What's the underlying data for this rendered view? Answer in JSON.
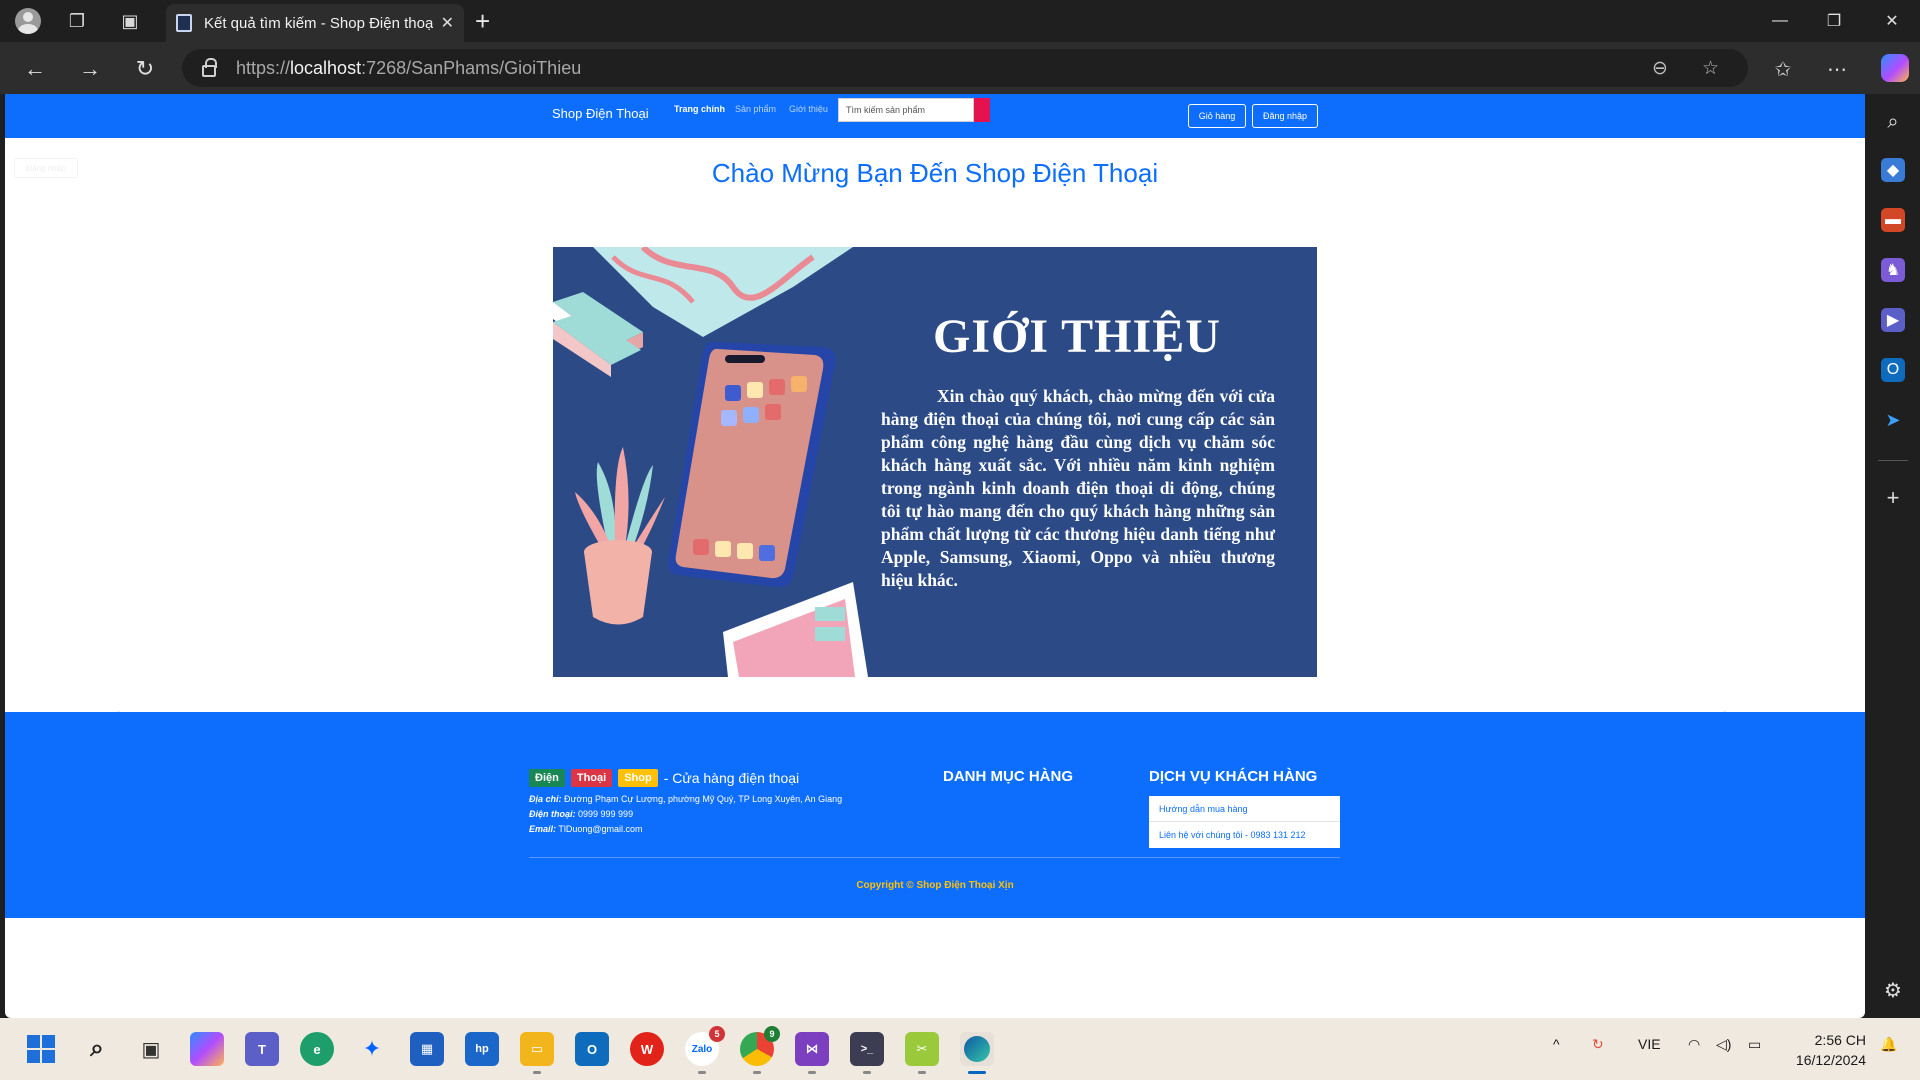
{
  "browser": {
    "tab_title": "Kết quả tìm kiếm - Shop Điện thoại",
    "url_prefix": "https://",
    "url_host": "localhost",
    "url_rest": ":7268/SanPhams/GioiThieu"
  },
  "site": {
    "brand": "Shop Điện Thoại",
    "nav": [
      "Trang chính",
      "Sản phẩm",
      "Giới thiệu"
    ],
    "search_placeholder": "Tìm kiếm sản phẩm",
    "cart_label": "Giỏ hàng",
    "login_label": "Đăng nhập",
    "ghost_button": "Đăng nhập"
  },
  "welcome": "Chào Mừng Bạn Đến Shop Điện Thoại",
  "banner": {
    "title": "GIỚI THIỆU",
    "text": "Xin chào quý khách, chào mừng đến với cửa hàng điện thoại của chúng tôi, nơi cung cấp các sản phẩm công nghệ hàng đầu cùng dịch vụ chăm sóc khách hàng xuất sắc. Với nhiều năm kinh nghiệm trong ngành kinh doanh điện thoại di động, chúng tôi tự hào mang đến cho quý khách hàng những sản phẩm chất lượng từ các thương hiệu danh tiếng như Apple, Samsung, Xiaomi, Oppo và nhiều thương hiệu khác."
  },
  "footer": {
    "tags": [
      "Điện",
      "Thoại",
      "Shop"
    ],
    "tagline": "- Cửa hàng điện thoại",
    "address_label": "Địa chỉ:",
    "address": "Đường Phạm Cự Lượng, phường Mỹ Quý, TP Long Xuyên, An Giang",
    "phone_label": "Điện thoại:",
    "phone": "0999 999 999",
    "email_label": "Email:",
    "email": "TlDuong@gmail.com",
    "category_heading": "DANH MỤC HÀNG",
    "service_heading": "DỊCH VỤ KHÁCH HÀNG",
    "services": [
      "Hướng dẫn mua hàng",
      "Liên hệ với chúng tôi - 0983 131 212"
    ],
    "copyright": "Copyright © Shop Điện Thoại Xịn"
  },
  "taskbar": {
    "zalo_badge": "5",
    "chrome_badge": "9",
    "language": "VIE",
    "time": "2:56 CH",
    "date": "16/12/2024"
  },
  "colors": {
    "primary": "#0d6efd",
    "banner_bg": "#2b4a86",
    "tag_green": "#198754",
    "tag_red": "#dc3545",
    "tag_yellow": "#ffc107"
  }
}
